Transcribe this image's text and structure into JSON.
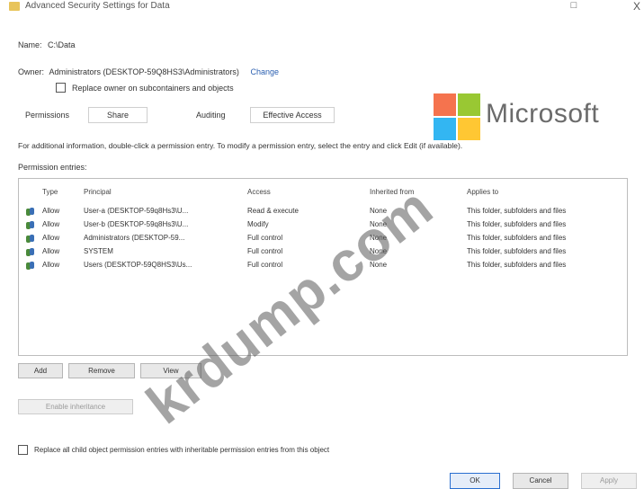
{
  "window": {
    "title": "Advanced Security Settings for Data",
    "minimize_glyph": "□",
    "close_glyph": "X"
  },
  "name": {
    "label": "Name:",
    "value": "C:\\Data"
  },
  "owner": {
    "label": "Owner:",
    "value": "Administrators (DESKTOP-59Q8HS3\\Administrators)",
    "change_link": "Change",
    "replace_owner_label": "Replace owner on subcontainers and objects"
  },
  "tabs": [
    {
      "label": "Permissions"
    },
    {
      "label": "Share"
    },
    {
      "label": "Auditing"
    },
    {
      "label": "Effective Access"
    }
  ],
  "logo": {
    "text": "Microsoft",
    "colors": [
      "#f25022",
      "#7fba00",
      "#00a4ef",
      "#ffb900"
    ]
  },
  "info_text": "For additional information, double-click a permission entry. To modify a permission entry, select the entry and click Edit (if available).",
  "entries_label": "Permission entries:",
  "table": {
    "headers": [
      "Type",
      "Principal",
      "Access",
      "Inherited from",
      "Applies to"
    ],
    "rows": [
      {
        "type": "Allow",
        "principal": "User-a (DESKTOP-59q8Hs3\\U...",
        "access": "Read & execute",
        "inherited": "None",
        "applies": "This folder, subfolders and files"
      },
      {
        "type": "Allow",
        "principal": "User-b (DESKTOP-59q8Hs3\\U...",
        "access": "Modify",
        "inherited": "None",
        "applies": "This folder, subfolders and files"
      },
      {
        "type": "Allow",
        "principal": "Administrators (DESKTOP-59...",
        "access": "Full control",
        "inherited": "None",
        "applies": "This folder, subfolders and files"
      },
      {
        "type": "Allow",
        "principal": "SYSTEM",
        "access": "Full control",
        "inherited": "None",
        "applies": "This folder, subfolders and files"
      },
      {
        "type": "Allow",
        "principal": "Users (DESKTOP-59Q8HS3\\Us...",
        "access": "Full control",
        "inherited": "None",
        "applies": "This folder, subfolders and files"
      }
    ]
  },
  "buttons": {
    "add": "Add",
    "remove": "Remove",
    "view": "View",
    "enable_inheritance": "Enable inheritance",
    "ok": "OK",
    "cancel": "Cancel",
    "apply": "Apply"
  },
  "replace_child_label": "Replace all child object permission entries with inheritable permission entries from this object",
  "watermark": "krdump.com"
}
